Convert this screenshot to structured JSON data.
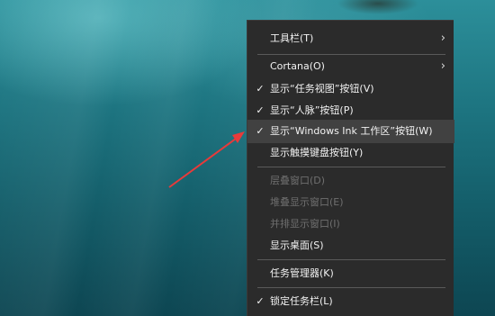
{
  "menu": {
    "items": [
      {
        "label": "工具栏(T)",
        "checked": false,
        "submenu": true,
        "disabled": false
      },
      {
        "label": "Cortana(O)",
        "checked": false,
        "submenu": true,
        "disabled": false
      },
      {
        "label": "显示“任务视图”按钮(V)",
        "checked": true,
        "submenu": false,
        "disabled": false
      },
      {
        "label": "显示“人脉”按钮(P)",
        "checked": true,
        "submenu": false,
        "disabled": false
      },
      {
        "label": "显示“Windows Ink 工作区”按钮(W)",
        "checked": true,
        "submenu": false,
        "disabled": false,
        "hovered": true
      },
      {
        "label": "显示触摸键盘按钮(Y)",
        "checked": false,
        "submenu": false,
        "disabled": false
      },
      {
        "label": "层叠窗口(D)",
        "checked": false,
        "submenu": false,
        "disabled": true
      },
      {
        "label": "堆叠显示窗口(E)",
        "checked": false,
        "submenu": false,
        "disabled": true
      },
      {
        "label": "并排显示窗口(I)",
        "checked": false,
        "submenu": false,
        "disabled": true
      },
      {
        "label": "显示桌面(S)",
        "checked": false,
        "submenu": false,
        "disabled": false
      },
      {
        "label": "任务管理器(K)",
        "checked": false,
        "submenu": false,
        "disabled": false
      },
      {
        "label": "锁定任务栏(L)",
        "checked": true,
        "submenu": false,
        "disabled": false
      }
    ],
    "check_glyph": "✓",
    "chevron_glyph": "›"
  },
  "colors": {
    "menu_bg": "#2b2b2b",
    "menu_hover": "#414141",
    "menu_text": "#f2f2f2",
    "disabled_text": "#6f6f6f",
    "arrow": "#e83a3a"
  }
}
